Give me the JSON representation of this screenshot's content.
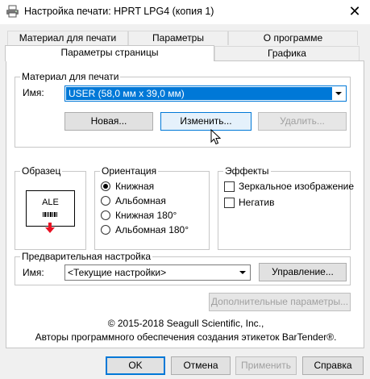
{
  "window": {
    "title": "Настройка печати: HPRT LPG4 (копия 1)",
    "close_glyph": "✕"
  },
  "tabs": {
    "row_back": [
      "Материал для печати",
      "Параметры",
      "О программе"
    ],
    "row_front": [
      "Параметры страницы",
      "Графика"
    ],
    "active": "Параметры страницы"
  },
  "media": {
    "group_label": "Материал для печати",
    "name_label": "Имя:",
    "name_value": "USER (58,0 мм x 39,0 мм)",
    "new_button": "Новая...",
    "edit_button": "Изменить...",
    "delete_button": "Удалить..."
  },
  "sample": {
    "group_label": "Образец",
    "label_text": "ALE"
  },
  "orientation": {
    "group_label": "Ориентация",
    "options": [
      "Книжная",
      "Альбомная",
      "Книжная 180°",
      "Альбомная 180°"
    ],
    "selected": "Книжная"
  },
  "effects": {
    "group_label": "Эффекты",
    "mirror": "Зеркальное изображение",
    "negative": "Негатив",
    "mirror_checked": false,
    "negative_checked": false
  },
  "preset": {
    "group_label": "Предварительная настройка",
    "name_label": "Имя:",
    "name_value": "<Текущие настройки>",
    "manage_button": "Управление...",
    "advanced_button": "Дополнительные параметры..."
  },
  "footer": {
    "copyright": "© 2015-2018 Seagull Scientific, Inc.,",
    "authors": "Авторы программного обеспечения создания этикеток BarTender®."
  },
  "buttons": {
    "ok": "OK",
    "cancel": "Отмена",
    "apply": "Применить",
    "help": "Справка"
  },
  "colors": {
    "selection": "#0078d7",
    "arrow_red": "#e81123"
  }
}
